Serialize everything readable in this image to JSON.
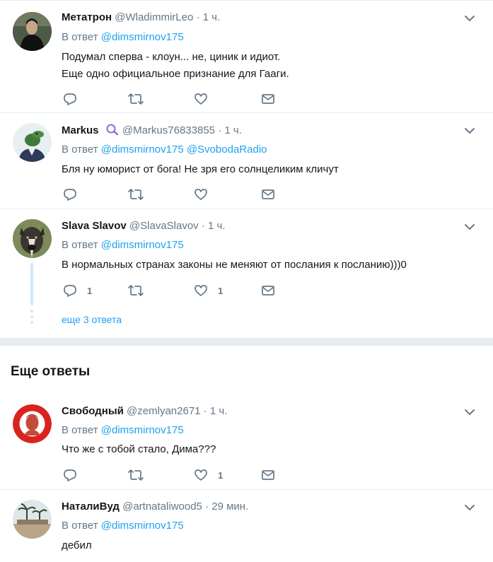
{
  "tweets": [
    {
      "name": "Метатрон",
      "handle": "@WladimmirLeo",
      "sep": "·",
      "time": "1 ч.",
      "reply_prefix": "В ответ",
      "mentions": [
        "@dimsmirnov175"
      ],
      "lines": [
        "Подумал сперва - клоун... не, циник и идиот.",
        "Еще одно официальное признание для Гааги."
      ]
    },
    {
      "name": "Markus",
      "handle": "@Markus76833855",
      "sep": "·",
      "time": "1 ч.",
      "reply_prefix": "В ответ",
      "mentions": [
        "@dimsmirnov175",
        "@SvobodaRadio"
      ],
      "lines": [
        "Бля ну юморист от бога! Не зря его солнцеликим кличут"
      ]
    },
    {
      "name": "Slava Slavov",
      "handle": "@SlavaSlavov",
      "sep": "·",
      "time": "1 ч.",
      "reply_prefix": "В ответ",
      "mentions": [
        "@dimsmirnov175"
      ],
      "lines": [
        "В нормальных странах законы не меняют от послания к посланию)))0"
      ],
      "reply_count": "1",
      "like_count": "1",
      "more_replies": "еще 3 ответа"
    },
    {
      "name": "Свободный",
      "handle": "@zemlyan2671",
      "sep": "·",
      "time": "1 ч.",
      "reply_prefix": "В ответ",
      "mentions": [
        "@dimsmirnov175"
      ],
      "lines": [
        "Что же с тобой стало, Дима???"
      ],
      "like_count": "1"
    },
    {
      "name": "НаталиВуд",
      "handle": "@artnataliwood5",
      "sep": "·",
      "time": "29 мин.",
      "reply_prefix": "В ответ",
      "mentions": [
        "@dimsmirnov175"
      ],
      "lines": [
        "дебил"
      ]
    }
  ],
  "section_title": "Еще ответы",
  "colors": {
    "accent": "#1da1f2",
    "muted": "#657786",
    "divider": "#e6ecf0",
    "text": "#14171a"
  },
  "icons": [
    "reply-icon",
    "retweet-icon",
    "like-icon",
    "direct-message-icon",
    "chevron-down-icon",
    "verified-badge-icon"
  ]
}
